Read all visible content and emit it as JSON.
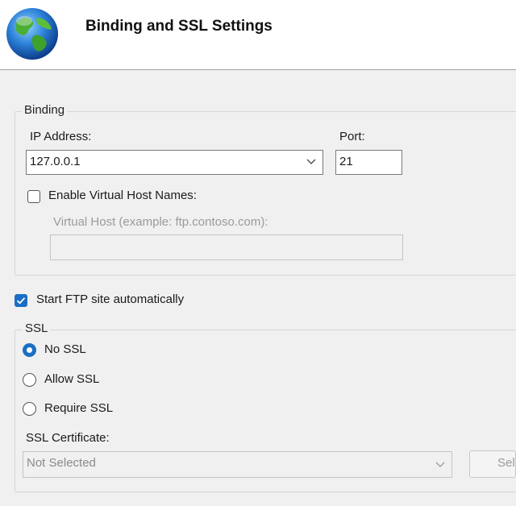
{
  "header": {
    "title": "Binding and SSL Settings",
    "icon": "globe-icon"
  },
  "binding": {
    "legend": "Binding",
    "ip_label": "IP Address:",
    "ip_value": "127.0.0.1",
    "port_label": "Port:",
    "port_value": "21",
    "virtual_host_checkbox_label": "Enable Virtual Host Names:",
    "virtual_host_checked": false,
    "virtual_host_label": "Virtual Host (example: ftp.contoso.com):",
    "virtual_host_value": ""
  },
  "start_ftp": {
    "label": "Start FTP site automatically",
    "checked": true
  },
  "ssl": {
    "legend": "SSL",
    "options": [
      {
        "label": "No SSL",
        "checked": true
      },
      {
        "label": "Allow SSL",
        "checked": false
      },
      {
        "label": "Require SSL",
        "checked": false
      }
    ],
    "cert_label": "SSL Certificate:",
    "cert_value": "Not Selected",
    "select_button": "Select..."
  },
  "colors": {
    "accent": "#1a6fc4"
  }
}
